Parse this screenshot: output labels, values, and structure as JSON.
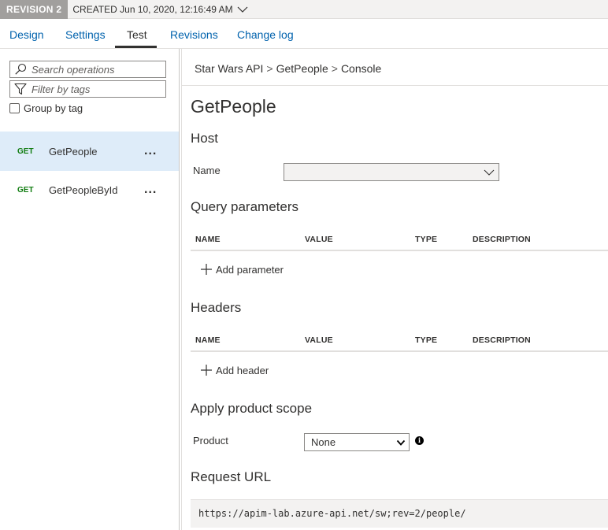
{
  "revision": {
    "badge": "REVISION 2",
    "created": "CREATED Jun 10, 2020, 12:16:49 AM"
  },
  "tabs": [
    {
      "label": "Design"
    },
    {
      "label": "Settings"
    },
    {
      "label": "Test",
      "active": true
    },
    {
      "label": "Revisions"
    },
    {
      "label": "Change log"
    }
  ],
  "sidebar": {
    "search_placeholder": "Search operations",
    "filter_placeholder": "Filter by tags",
    "group_by_label": "Group by tag",
    "group_by_checked": false,
    "operations": [
      {
        "method": "GET",
        "name": "GetPeople",
        "more": "...",
        "selected": true
      },
      {
        "method": "GET",
        "name": "GetPeopleById",
        "more": "..."
      }
    ]
  },
  "breadcrumb": {
    "items": [
      "Star Wars API",
      "GetPeople",
      "Console"
    ],
    "separator": ">"
  },
  "console": {
    "title": "GetPeople",
    "host": {
      "heading": "Host",
      "name_label": "Name",
      "name_value": ""
    },
    "query": {
      "heading": "Query parameters",
      "columns": [
        "NAME",
        "VALUE",
        "TYPE",
        "DESCRIPTION"
      ],
      "add_label": "Add parameter"
    },
    "headers": {
      "heading": "Headers",
      "columns": [
        "NAME",
        "VALUE",
        "TYPE",
        "DESCRIPTION"
      ],
      "add_label": "Add header"
    },
    "scope": {
      "heading": "Apply product scope",
      "product_label": "Product",
      "product_value": "None",
      "info_glyph": "i"
    },
    "request_url": {
      "heading": "Request URL",
      "value": "https://apim-lab.azure-api.net/sw;rev=2/people/"
    }
  },
  "colors": {
    "link": "#0062ad",
    "method_get": "#107c10",
    "selected_row": "#deecf9",
    "revision_badge": "#a19f9d"
  }
}
